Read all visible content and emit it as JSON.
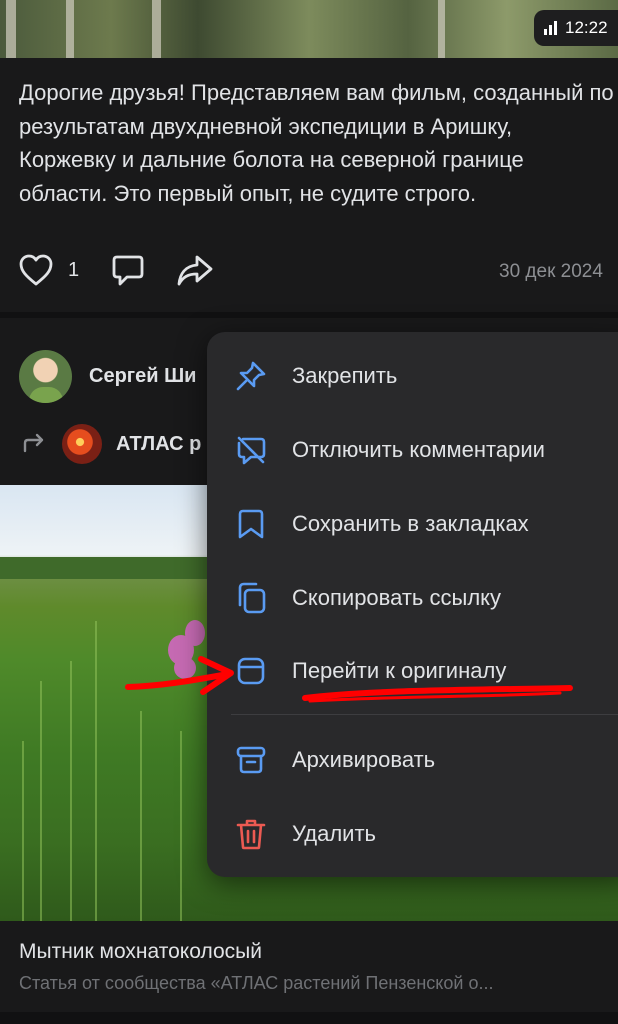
{
  "status": {
    "time": "12:22"
  },
  "post": {
    "text": "Дорогие друзья! Представляем вам фильм, созданный по результатам двухдневной экспедиции в Аришку, Коржевку и дальние болота на северной границе области. Это первый опыт, не судите строго.",
    "likes": "1",
    "date": "30 дек 2024"
  },
  "next_post": {
    "author": "Сергей Ши",
    "repost_source": "АТЛАС р",
    "caption_title": "Мытник мохнатоколосый",
    "caption_subtitle": "Статья от сообщества «АТЛАС растений Пензенской о..."
  },
  "menu": {
    "items": [
      {
        "label": "Закрепить",
        "icon": "pin-icon"
      },
      {
        "label": "Отключить комментарии",
        "icon": "comments-off-icon"
      },
      {
        "label": "Сохранить в закладках",
        "icon": "bookmark-icon"
      },
      {
        "label": "Скопировать ссылку",
        "icon": "copy-icon"
      },
      {
        "label": "Перейти к оригиналу",
        "icon": "original-icon"
      },
      {
        "label": "Архивировать",
        "icon": "archive-icon"
      },
      {
        "label": "Удалить",
        "icon": "trash-icon"
      }
    ]
  },
  "colors": {
    "accent": "#5a9bf2",
    "danger": "#ec5a52",
    "annotation": "#ff0000",
    "background": "#19191a",
    "menu_background": "#29292b"
  }
}
